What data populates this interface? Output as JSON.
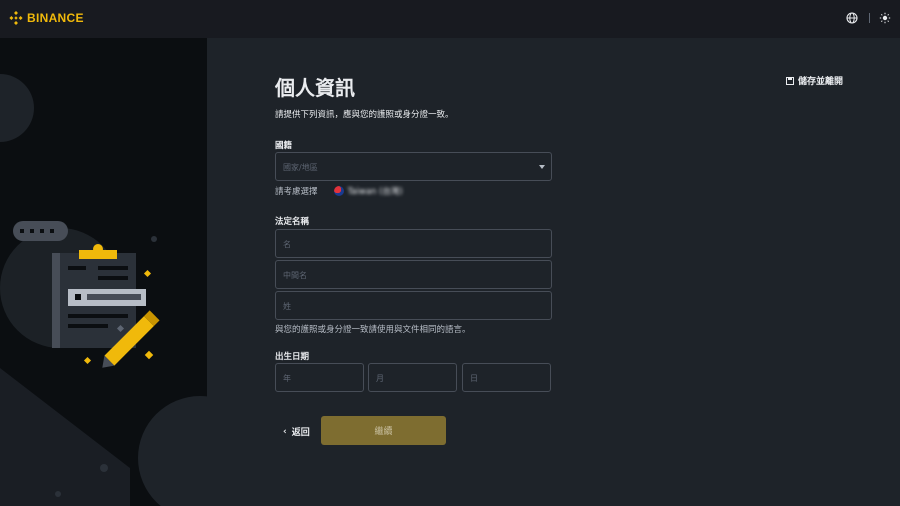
{
  "header": {
    "brand": "BINANCE",
    "brand_color": "#f0b90b",
    "icons": [
      "globe-icon",
      "theme-toggle-icon"
    ]
  },
  "form": {
    "title": "個人資訊",
    "save_exit": "儲存並離開",
    "subtitle": "請提供下列資訊，應與您的護照或身分證一致。",
    "nationality": {
      "label": "國籍",
      "placeholder": "國家/地區",
      "suggest_label": "請考慮選擇",
      "suggest_value": "Taiwan (台灣)"
    },
    "legal_name": {
      "label": "法定名稱",
      "first_placeholder": "名",
      "middle_placeholder": "中間名",
      "last_placeholder": "姓",
      "note": "與您的護照或身分證一致請使用與文件相同的語言。"
    },
    "dob": {
      "label": "出生日期",
      "year_placeholder": "年",
      "month_placeholder": "月",
      "day_placeholder": "日"
    },
    "back_label": "返回",
    "continue_label": "繼續"
  }
}
